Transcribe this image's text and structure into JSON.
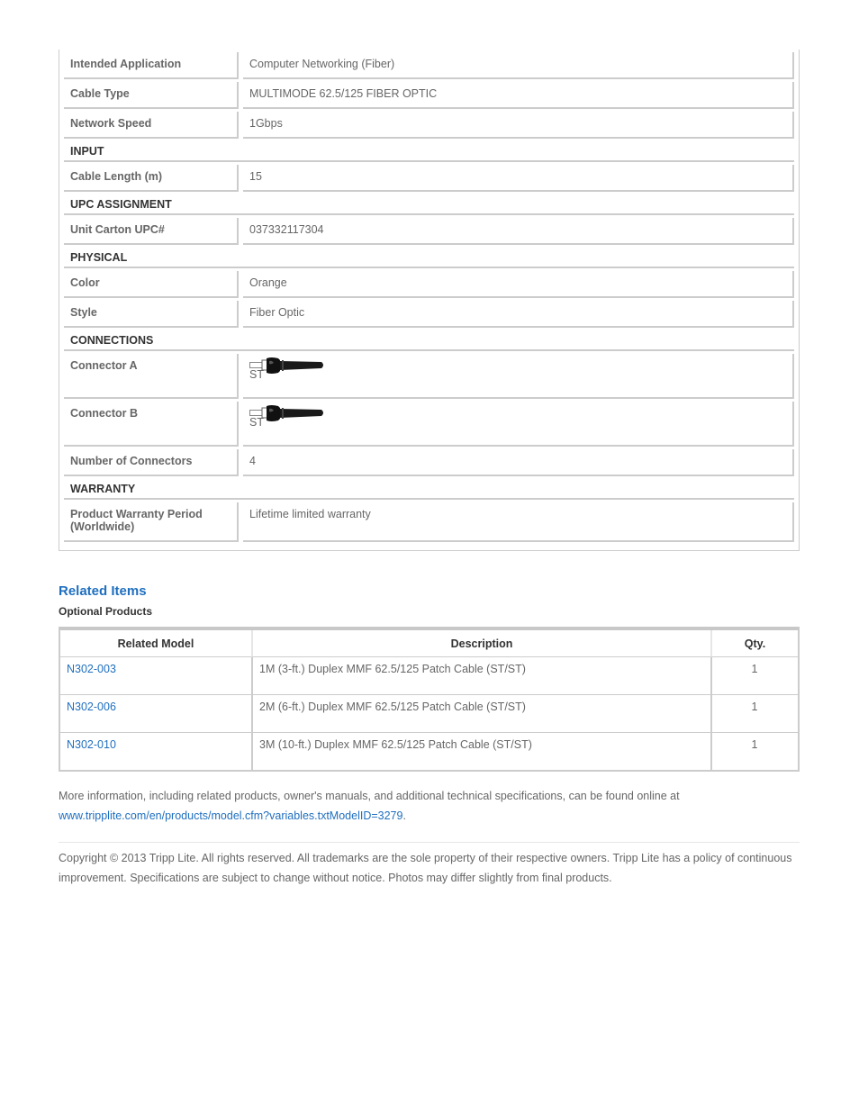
{
  "specs": {
    "rows": [
      {
        "type": "row",
        "label": "Intended Application",
        "value": "Computer Networking (Fiber)"
      },
      {
        "type": "row",
        "label": "Cable Type",
        "value": "MULTIMODE 62.5/125 FIBER OPTIC"
      },
      {
        "type": "row",
        "label": "Network Speed",
        "value": "1Gbps"
      },
      {
        "type": "section",
        "label": "INPUT"
      },
      {
        "type": "row",
        "label": "Cable Length (m)",
        "value": "15"
      },
      {
        "type": "section",
        "label": "UPC ASSIGNMENT"
      },
      {
        "type": "row",
        "label": "Unit Carton UPC#",
        "value": "037332117304"
      },
      {
        "type": "section",
        "label": "PHYSICAL"
      },
      {
        "type": "row",
        "label": "Color",
        "value": "Orange"
      },
      {
        "type": "row",
        "label": "Style",
        "value": "Fiber Optic"
      },
      {
        "type": "section",
        "label": "CONNECTIONS"
      },
      {
        "type": "connector",
        "label": "Connector A",
        "icon": "st-connector-icon",
        "value": "ST"
      },
      {
        "type": "connector",
        "label": "Connector B",
        "icon": "st-connector-icon",
        "value": "ST"
      },
      {
        "type": "row",
        "label": "Number of Connectors",
        "value": "4"
      },
      {
        "type": "section",
        "label": "WARRANTY"
      },
      {
        "type": "warranty",
        "label": "Product Warranty Period (Worldwide)",
        "value": "Lifetime limited warranty"
      }
    ]
  },
  "related": {
    "title": "Related Items",
    "subtitle": "Optional Products",
    "columns": [
      "Related Model",
      "Description",
      "Qty."
    ],
    "items": [
      {
        "model": "N302-003",
        "description": "1M (3-ft.) Duplex MMF 62.5/125 Patch Cable (ST/ST)",
        "qty": "1"
      },
      {
        "model": "N302-006",
        "description": "2M (6-ft.) Duplex MMF 62.5/125 Patch Cable (ST/ST)",
        "qty": "1"
      },
      {
        "model": "N302-010",
        "description": "3M (10-ft.) Duplex MMF 62.5/125 Patch Cable (ST/ST)",
        "qty": "1"
      }
    ]
  },
  "footer": {
    "more_info_text": "More information, including related products, owner's manuals, and additional technical specifications, can be found online at",
    "more_info_link": "www.tripplite.com/en/products/model.cfm?variables.txtModelID=3279",
    "more_info_suffix": ".",
    "copyright": "Copyright © 2013 Tripp Lite. All rights reserved. All trademarks are the sole property of their respective owners. Tripp Lite has a policy of continuous improvement. Specifications are subject to change without notice. Photos may differ slightly from final products."
  },
  "colors": {
    "link": "#1f6fbf",
    "border": "#cccccc",
    "text": "#666666",
    "heading": "#333333"
  }
}
